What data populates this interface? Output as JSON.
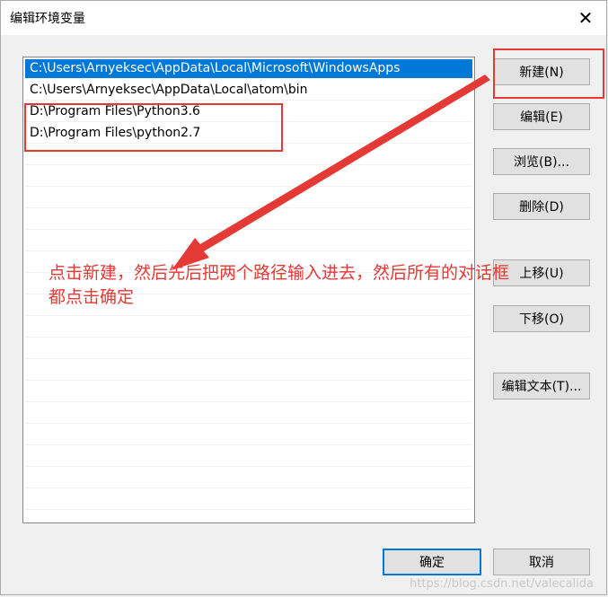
{
  "window": {
    "title": "编辑环境变量",
    "close_glyph": "✕"
  },
  "path_list": {
    "items": [
      "C:\\Users\\Arnyeksec\\AppData\\Local\\Microsoft\\WindowsApps",
      "C:\\Users\\Arnyeksec\\AppData\\Local\\atom\\bin",
      "D:\\Program Files\\Python3.6",
      "D:\\Program Files\\python2.7"
    ],
    "selected_index": 0
  },
  "buttons": {
    "new": "新建(N)",
    "edit": "编辑(E)",
    "browse": "浏览(B)...",
    "delete": "删除(D)",
    "move_up": "上移(U)",
    "move_down": "下移(O)",
    "edit_text": "编辑文本(T)...",
    "ok": "确定",
    "cancel": "取消"
  },
  "annotation": {
    "text": "点击新建，然后先后把两个路径输入进去，然后所有的对话框\n都点击确定",
    "color": "#e53935"
  },
  "watermark": "https://blog.csdn.net/valecalida",
  "colors": {
    "selection": "#0078d7",
    "annotation": "#e53935",
    "default_button_border": "#0078d7"
  },
  "icons": {
    "close": "close-icon",
    "arrow": "arrow-annotation"
  }
}
